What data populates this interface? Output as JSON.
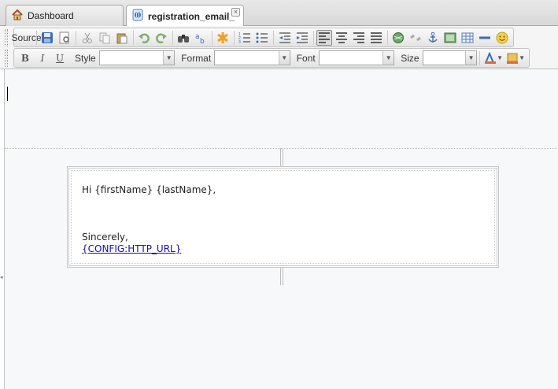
{
  "tabs": [
    {
      "label": "Dashboard",
      "icon": "home-icon",
      "active": false
    },
    {
      "label": "registration_email_",
      "icon": "globe-icon",
      "active": true,
      "close": "×"
    }
  ],
  "toolbar": {
    "source_label": "Source",
    "bold_label": "B",
    "italic_label": "I",
    "underline_label": "U",
    "style_label": "Style",
    "format_label": "Format",
    "font_label": "Font",
    "size_label": "Size",
    "style_value": "",
    "format_value": "",
    "font_value": "",
    "size_value": ""
  },
  "editor": {
    "greeting": "Hi {firstName} {lastName},",
    "signoff": "Sincerely,",
    "link": "{CONFIG:HTTP_URL}"
  },
  "colors": {
    "accent": "#3366aa",
    "link": "#1a0dab"
  }
}
